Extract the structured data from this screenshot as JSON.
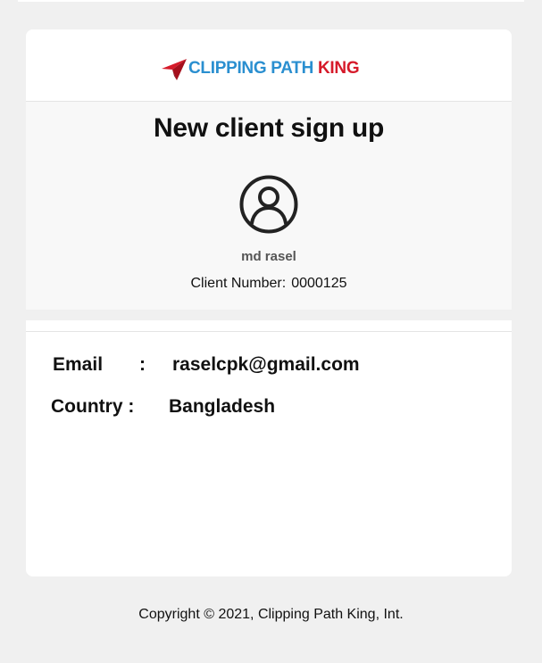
{
  "brand": {
    "name_part1": "CLIPPING PATH ",
    "name_part2": "KING",
    "logo_icon": "paper-plane-logo-icon",
    "blue": "#2a8fd0",
    "red": "#d61a2a"
  },
  "header": {
    "title": "New client sign up"
  },
  "profile": {
    "avatar_icon": "user-avatar-icon",
    "name": "md rasel",
    "client_number_label": "Client Number:",
    "client_number": "0000125"
  },
  "details": {
    "email_label": "Email",
    "email_colon": ":",
    "email_value": "raselcpk@gmail.com",
    "country_label": "Country :",
    "country_value": "Bangladesh"
  },
  "footer": {
    "copyright": "Copyright © 2021, Clipping Path King, Int."
  }
}
